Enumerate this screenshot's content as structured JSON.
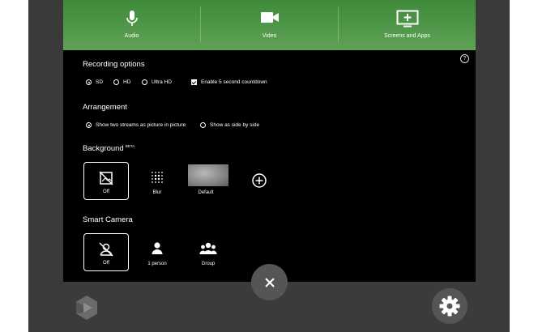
{
  "toolbar": {
    "audio": {
      "label": "Audio",
      "icon": "microphone-icon"
    },
    "video": {
      "label": "Video",
      "icon": "video-camera-icon"
    },
    "screens": {
      "label": "Screens and Apps",
      "icon": "screen-add-icon"
    }
  },
  "recording": {
    "title": "Recording options",
    "options": [
      {
        "label": "SD",
        "selected": true
      },
      {
        "label": "HD",
        "selected": false
      },
      {
        "label": "Ultra HD",
        "selected": false
      }
    ],
    "countdown": {
      "label": "Enable 5 second countdown",
      "checked": true
    }
  },
  "arrangement": {
    "title": "Arrangement",
    "options": [
      {
        "label": "Show two streams as picture in picture",
        "selected": true
      },
      {
        "label": "Show as side by side",
        "selected": false
      }
    ]
  },
  "background": {
    "title": "Background",
    "badge": "BETA",
    "options": [
      {
        "label": "Off",
        "selected": true
      },
      {
        "label": "Blur",
        "selected": false
      },
      {
        "label": "Default",
        "selected": false
      }
    ]
  },
  "smart_camera": {
    "title": "Smart Camera",
    "options": [
      {
        "label": "Off",
        "selected": true
      },
      {
        "label": "1 person",
        "selected": false
      },
      {
        "label": "Group",
        "selected": false
      }
    ]
  },
  "colors": {
    "toolbar": "#4f9a47",
    "panel": "#000000",
    "bottombar": "#3b3b3b",
    "button": "#555555"
  },
  "help_icon": "?",
  "close_icon": "×"
}
